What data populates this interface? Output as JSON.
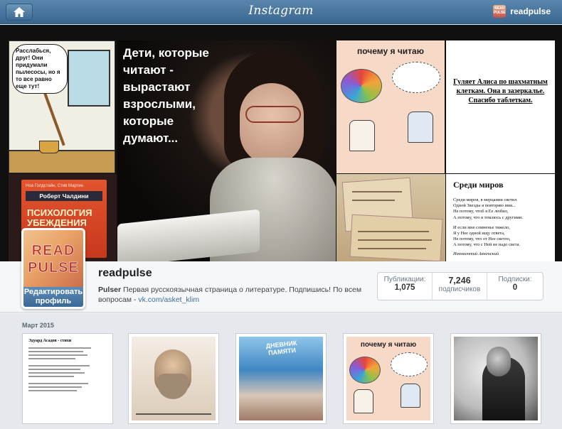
{
  "topbar": {
    "logo": "Instagram",
    "username": "readpulse",
    "mini_avatar": "READ PULSE"
  },
  "cover": {
    "comic_text": "Расслабься, друг! Они придумали пылесосы, но я то все равно еще тут!",
    "book_authors": "Ноа Голдстайн, Стив Мартин",
    "book_author": "Роберт Чалдини",
    "book_title": "ПСИХОЛОГИЯ УБЕЖДЕНИЯ",
    "photo_quote": "Дети, которые читают - вырастают взрослыми, которые думают...",
    "why_title": "почему я читаю",
    "alice_text": "Гуляет Алиса по шахматным клеткам. Она в зазеркалье. Спасибо таблеткам.",
    "poem": {
      "title": "Среди миров",
      "stanza1": [
        "Среди миров, в мерцании светил",
        "Одной Звезды я повторяю имя...",
        "Не потому, чтоб я Ее любил,",
        "А потому, что я томлюсь с другими."
      ],
      "stanza2": [
        "И если мне сомненье тяжело,",
        "Я у Нее одной ищу ответа,",
        "Не потому, что от Нее светло,",
        "А потому, что с Ней не надо света."
      ],
      "author": "Иннокентий Анненский"
    }
  },
  "profile": {
    "avatar_word1": "READ",
    "avatar_word2": "PULSE",
    "edit_label": "Редактировать профиль",
    "username": "readpulse",
    "bio_name": "Pulser",
    "bio_text": "Первая русскоязычная страница о литературе. Подпишись! По всем вопросам -",
    "bio_link": "vk.com/asket_klim",
    "stats": [
      {
        "label": "Публикации:",
        "value": "1,075"
      },
      {
        "label": "подписчиков",
        "value": "7,246"
      },
      {
        "label": "Подписки:",
        "value": "0"
      }
    ]
  },
  "feed": {
    "month": "Март 2015",
    "thumb1_title": "Эдуард Асадов - стихи",
    "thumb3_title": "ДНЕВНИК ПАМЯТИ",
    "thumb4_title": "почему я читаю"
  }
}
